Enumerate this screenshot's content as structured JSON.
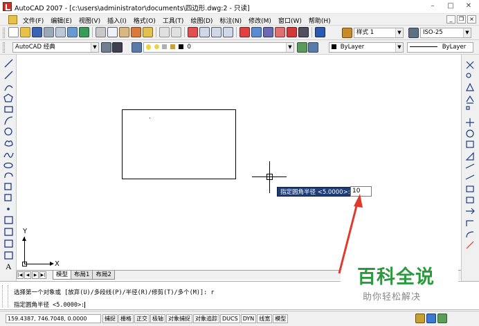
{
  "window": {
    "title": "AutoCAD 2007 - [c:\\users\\administrator\\documents\\四边形.dwg:2 - 只读]",
    "minimize": "–",
    "maximize": "□",
    "close": "✕"
  },
  "menu": {
    "items": [
      "文件(F)",
      "编辑(E)",
      "视图(V)",
      "插入(I)",
      "格式(O)",
      "工具(T)",
      "绘图(D)",
      "标注(N)",
      "修改(M)",
      "窗口(W)",
      "帮助(H)"
    ],
    "mdi_minimize": "_",
    "mdi_restore": "❐",
    "mdi_close": "×"
  },
  "toolbar": {
    "text_style": "样式 1",
    "dim_style": "ISO-25",
    "workspace": "AutoCAD 经典",
    "layer": "0",
    "color": "ByLayer",
    "linetype": "ByLayer"
  },
  "drawing": {
    "prompt_label": "指定圆角半径 <5.0000>:",
    "prompt_value": "10",
    "ucs_y": "Y",
    "ucs_x": "X"
  },
  "tabs": {
    "nav": [
      "|◀",
      "◀",
      "▶",
      "▶|"
    ],
    "items": [
      "模型",
      "布局1",
      "布局2"
    ]
  },
  "command": {
    "history": "选择第一个对象或 [放弃(U)/多段线(P)/半径(R)/修剪(T)/多个(M)]: r",
    "current": "指定圆角半径 <5.0000>:"
  },
  "status": {
    "coords": "159.4387, 746.7048, 0.0000",
    "buttons": [
      "捕捉",
      "栅格",
      "正交",
      "极轴",
      "对象捕捉",
      "对象追踪",
      "DUCS",
      "DYN",
      "线宽",
      "模型"
    ]
  },
  "watermark": {
    "title": "百科全说",
    "subtitle": "助你轻松解决"
  },
  "colors": {
    "accent_arrow": "#e03a2f",
    "tooltip_bg": "#1e3c78",
    "watermark_green": "#2a9a3c"
  }
}
